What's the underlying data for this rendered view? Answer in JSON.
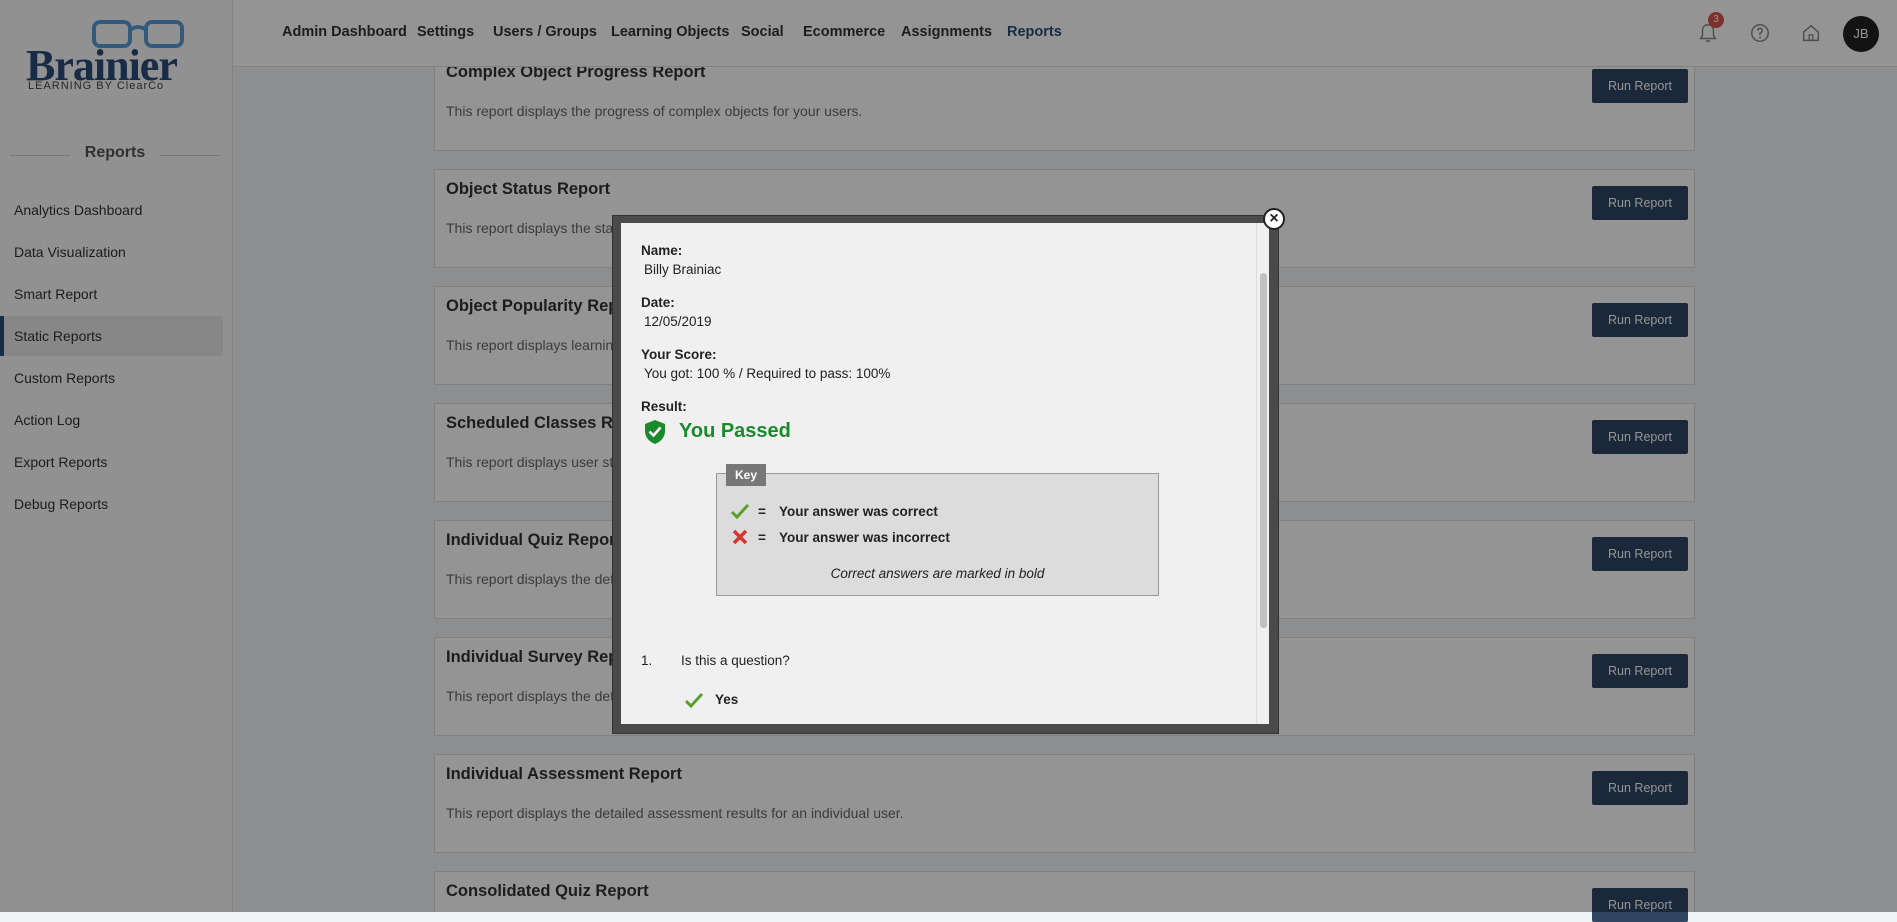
{
  "logo": {
    "name": "Brainier",
    "tagline": "LEARNING BY ClearCo"
  },
  "sidebar": {
    "title": "Reports",
    "items": [
      {
        "label": "Analytics Dashboard"
      },
      {
        "label": "Data Visualization"
      },
      {
        "label": "Smart Report"
      },
      {
        "label": "Static Reports"
      },
      {
        "label": "Custom Reports"
      },
      {
        "label": "Action Log"
      },
      {
        "label": "Export Reports"
      },
      {
        "label": "Debug Reports"
      }
    ]
  },
  "topnav": {
    "items": [
      {
        "label": "Admin Dashboard"
      },
      {
        "label": "Settings"
      },
      {
        "label": "Users / Groups"
      },
      {
        "label": "Learning Objects"
      },
      {
        "label": "Social"
      },
      {
        "label": "Ecommerce"
      },
      {
        "label": "Assignments"
      },
      {
        "label": "Reports"
      }
    ],
    "notification_count": "3",
    "avatar_initials": "JB"
  },
  "reports": {
    "run_label": "Run Report",
    "items": [
      {
        "title": "Complex Object Progress Report",
        "desc": "This report displays the progress of complex objects for your users."
      },
      {
        "title": "Object Status Report",
        "desc": "This report displays the sta"
      },
      {
        "title": "Object Popularity Report",
        "desc": "This report displays learnin"
      },
      {
        "title": "Scheduled Classes Report",
        "desc": "This report displays user st"
      },
      {
        "title": "Individual Quiz Report",
        "desc": "This report displays the det"
      },
      {
        "title": "Individual Survey Report",
        "desc": "This report displays the det"
      },
      {
        "title": "Individual Assessment Report",
        "desc": "This report displays the detailed assessment results for an individual user."
      },
      {
        "title": "Consolidated Quiz Report",
        "desc": ""
      }
    ]
  },
  "modal": {
    "name_label": "Name:",
    "name_value": "Billy Brainiac",
    "date_label": "Date:",
    "date_value": "12/05/2019",
    "score_label": "Your Score:",
    "score_value": "You got: 100 % / Required to pass: 100%",
    "result_label": "Result:",
    "result_value": "You Passed",
    "key": {
      "tag": "Key",
      "eq": "=",
      "correct": "Your answer was correct",
      "incorrect": "Your answer was incorrect",
      "note": "Correct answers are marked in bold"
    },
    "question": {
      "number": "1.",
      "text": "Is this a question?",
      "answer": "Yes"
    }
  },
  "colors": {
    "brand": "#2c4c7a",
    "button": "#2f4562",
    "pass": "#1b8a2c",
    "badge": "#d9534f"
  }
}
